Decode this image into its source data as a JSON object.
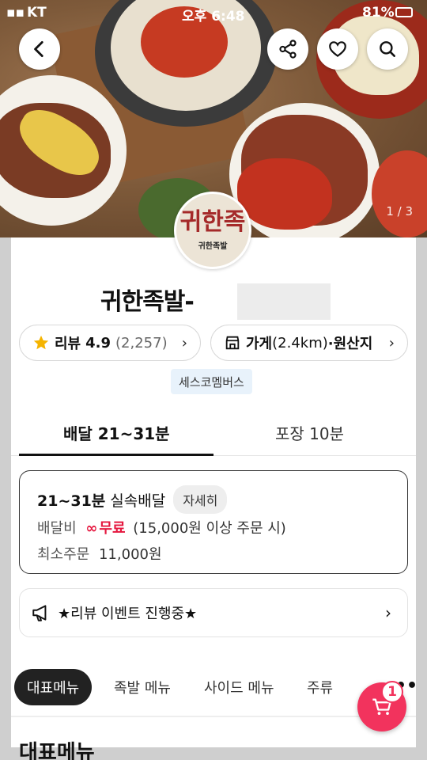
{
  "status_bar": {
    "carrier": "KT",
    "time": "오후 6:48",
    "battery": "81%"
  },
  "hero": {
    "pager": "1 / 3"
  },
  "header": {
    "back_icon": "back-icon",
    "share_icon": "share-icon",
    "favorite_icon": "heart-icon",
    "search_icon": "search-icon"
  },
  "store": {
    "logo_mark": "귀한족",
    "logo_name": "귀한족발",
    "title": "귀한족발-",
    "review_label": "리뷰",
    "review_score": "4.9",
    "review_count": "(2,257)",
    "shop_label": "가게",
    "shop_distance": "(2.4km)",
    "origin_label": "·원산지",
    "tag": "세스코멤버스"
  },
  "tabs": {
    "delivery": "배달 21~31분",
    "pickup": "포장 10분"
  },
  "delivery_info": {
    "time": "21~31분",
    "type": "실속배달",
    "detail_button": "자세히",
    "fee_label": "배달비",
    "fee_value": "무료",
    "fee_note": "(15,000원 이상 주문 시)",
    "min_order_label": "최소주문",
    "min_order_value": "11,000원"
  },
  "event": {
    "text": "★리뷰 이벤트 진행중★"
  },
  "menu_tabs": [
    "대표메뉴",
    "족발 메뉴",
    "사이드 메뉴",
    "주류"
  ],
  "section_title": "대표메뉴",
  "cart": {
    "count": "1"
  },
  "colors": {
    "accent": "#f2335d",
    "free": "#e5173f",
    "star": "#f5b400"
  }
}
